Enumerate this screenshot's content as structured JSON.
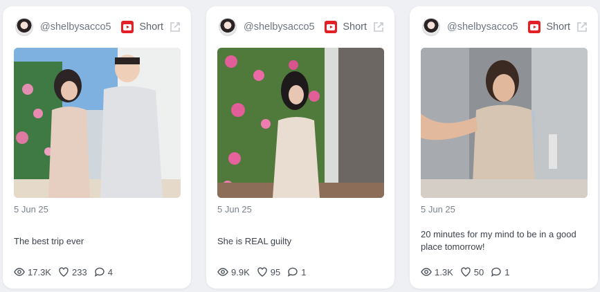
{
  "posts": [
    {
      "handle": "@shelbysacco5",
      "type_label": "Short",
      "platform_icon": "youtube-icon",
      "date": "5 Jun 25",
      "caption": "The best trip ever",
      "views": "17.3K",
      "likes": "233",
      "comments": "4",
      "thumbnail": "couple walking outdoors with pink flowers"
    },
    {
      "handle": "@shelbysacco5",
      "type_label": "Short",
      "platform_icon": "youtube-icon",
      "date": "5 Jun 25",
      "caption": "She is REAL guilty",
      "views": "9.9K",
      "likes": "95",
      "comments": "1",
      "thumbnail": "woman posing by pink flowering bush"
    },
    {
      "handle": "@shelbysacco5",
      "type_label": "Short",
      "platform_icon": "youtube-icon",
      "date": "5 Jun 25",
      "caption": "20 minutes for my mind to be in a good place tomorrow!",
      "views": "1.3K",
      "likes": "50",
      "comments": "1",
      "thumbnail": "woman talking in bathroom"
    }
  ],
  "colors": {
    "background": "#eef0f4",
    "card": "#ffffff",
    "youtube_red": "#e32025",
    "muted_text": "#7a818d"
  },
  "icons": [
    "youtube-icon",
    "external-link-icon",
    "eye-icon",
    "heart-icon",
    "comment-icon"
  ]
}
